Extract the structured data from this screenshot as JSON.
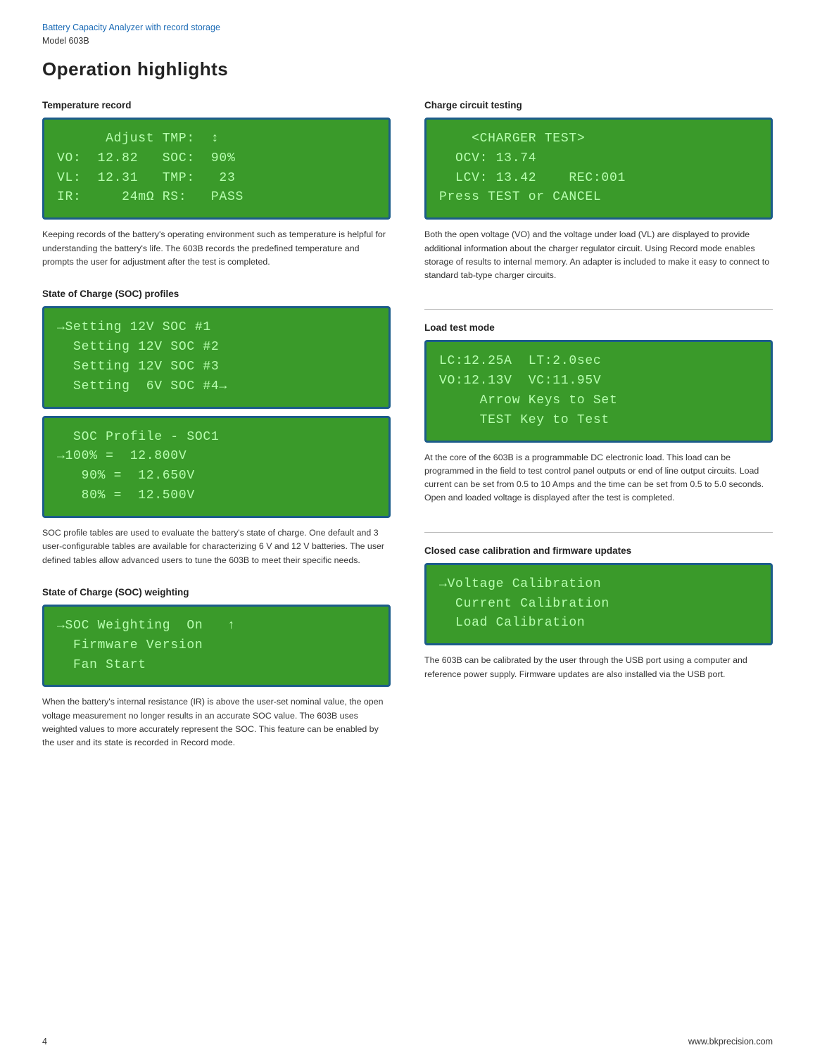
{
  "header": {
    "brand": "Battery Capacity Analyzer with record storage",
    "model": "Model 603B"
  },
  "page_title": "Operation highlights",
  "footer": {
    "page_number": "4",
    "website": "www.bkprecision.com"
  },
  "left_column": {
    "sections": [
      {
        "id": "temperature-record",
        "title": "Temperature record",
        "lcd_lines": [
          "      Adjust TMP:  ↑↓",
          "VO:  12.82   SOC:  90%",
          "VL:  12.31   TMP:   23",
          "IR:     24mΩ RS:   PASS"
        ],
        "description": "Keeping records of the battery's operating environment such as temperature is helpful for understanding the battery's life. The 603B records the predefined temperature and prompts the user for adjustment after the test is completed."
      },
      {
        "id": "soc-profiles",
        "title": "State of Charge (SOC) profiles",
        "lcd_screens": [
          {
            "lines": [
              "→Setting 12V SOC #1",
              "  Setting 12V SOC #2",
              "  Setting 12V SOC #3",
              "  Setting  6V SOC #4→"
            ]
          },
          {
            "lines": [
              "  SOC Profile - SOC1",
              "→100% =  12.800V",
              "   90% =  12.650V",
              "   80% =  12.500V"
            ]
          }
        ],
        "description": "SOC profile tables are used to evaluate the battery's state of charge. One default and 3 user-configurable tables are available for characterizing 6 V and 12 V batteries. The user defined tables allow advanced users to tune the 603B to meet their specific needs."
      },
      {
        "id": "soc-weighting",
        "title": "State of Charge (SOC) weighting",
        "lcd_lines": [
          "→SOC Weighting  On   ↑",
          "  Firmware Version",
          "  Fan Start"
        ],
        "description": "When the battery's internal resistance (IR) is above the user-set nominal value, the open voltage measurement no longer results in an accurate SOC value. The 603B uses weighted values to more accurately represent the SOC. This feature can be enabled by the user and its state is recorded in Record mode."
      }
    ]
  },
  "right_column": {
    "sections": [
      {
        "id": "charge-circuit",
        "title": "Charge circuit testing",
        "lcd_lines": [
          "    <CHARGER TEST>",
          "  OCV: 13.74",
          "  LCV: 13.42    REC:001",
          "Press TEST or CANCEL"
        ],
        "description": "Both the open voltage (VO) and the voltage under load (VL) are displayed to provide additional information about the charger regulator circuit. Using Record mode enables storage of results to internal memory. An adapter is included to make it easy to connect to standard tab-type charger circuits."
      },
      {
        "id": "load-test",
        "title": "Load test mode",
        "lcd_lines": [
          "LC:12.25A  LT:2.0sec",
          "VO:12.13V  VC:11.95V",
          "     Arrow Keys to Set",
          "     TEST Key to Test"
        ],
        "description": "At the core of the 603B is a programmable DC electronic load. This load can be programmed in the field to test control panel outputs or end of line output circuits. Load current can be set from 0.5 to 10 Amps and the time can be set from 0.5 to 5.0 seconds. Open and loaded voltage is displayed after the test is completed."
      },
      {
        "id": "closed-case",
        "title": "Closed case calibration and firmware updates",
        "lcd_lines": [
          "→Voltage Calibration",
          "  Current Calibration",
          "  Load Calibration"
        ],
        "description": "The 603B can be calibrated by the user through the USB port using a computer and reference power supply. Firmware updates are also installed via the USB port."
      }
    ]
  }
}
